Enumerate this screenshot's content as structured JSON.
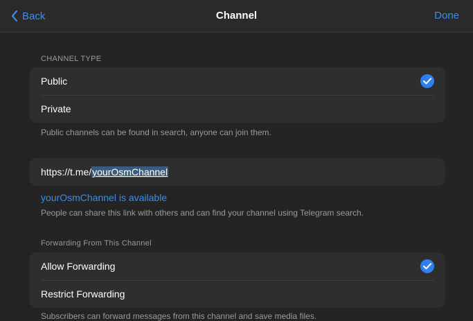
{
  "nav": {
    "back_label": "Back",
    "title": "Channel",
    "done_label": "Done"
  },
  "channel_type": {
    "header": "CHANNEL TYPE",
    "options": [
      {
        "label": "Public",
        "selected": true
      },
      {
        "label": "Private",
        "selected": false
      }
    ],
    "footer": "Public channels can be found in search, anyone can join them."
  },
  "link": {
    "prefix": "https://t.me/",
    "username": "yourOsmChannel",
    "availability": "yourOsmChannel is available",
    "footer": "People can share this link with others and can find your channel using Telegram search."
  },
  "forwarding": {
    "header": "Forwarding From This Channel",
    "options": [
      {
        "label": "Allow Forwarding",
        "selected": true
      },
      {
        "label": "Restrict Forwarding",
        "selected": false
      }
    ],
    "footer": "Subscribers can forward messages from this channel and save media files."
  },
  "colors": {
    "accent": "#3a8cf0",
    "background": "#242424",
    "group": "#2e2e2e"
  },
  "icons": {
    "back": "chevron-left-icon",
    "check": "checkmark-circle-icon"
  }
}
